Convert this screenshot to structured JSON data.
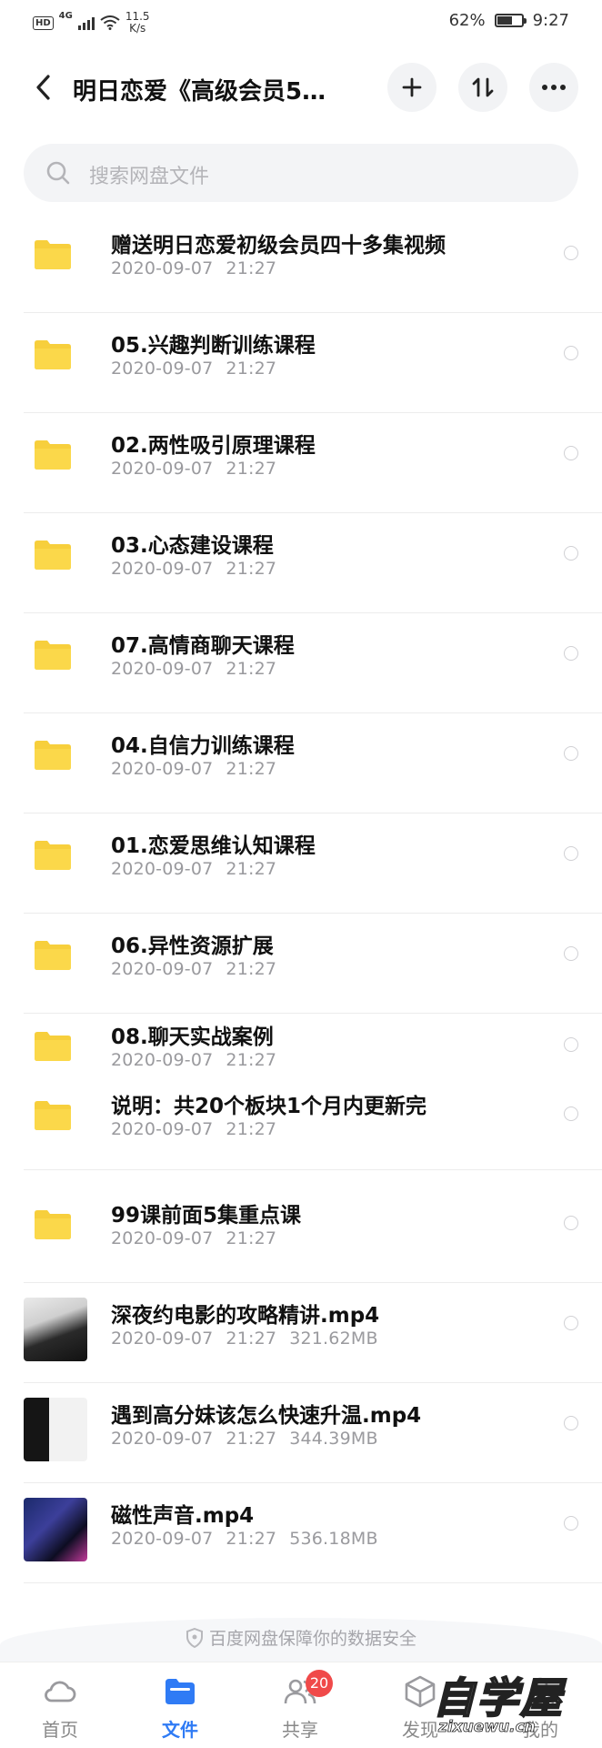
{
  "status_bar": {
    "hd": "HD",
    "network": "4G",
    "speed_value": "11.5",
    "speed_unit": "K/s",
    "battery": "62%",
    "battery_level": 0.62,
    "time": "9:27"
  },
  "header": {
    "title": "明日恋爱《高级会员5…",
    "icons": [
      "back-icon",
      "plus-icon",
      "sort-icon",
      "more-icon"
    ]
  },
  "search": {
    "placeholder": "搜索网盘文件"
  },
  "files": [
    {
      "name": "赠送明日恋爱初级会员四十多集视频",
      "date": "2020-09-07",
      "time": "21:27",
      "size": "",
      "type": "folder"
    },
    {
      "name": "05.兴趣判断训练课程",
      "date": "2020-09-07",
      "time": "21:27",
      "size": "",
      "type": "folder"
    },
    {
      "name": "02.两性吸引原理课程",
      "date": "2020-09-07",
      "time": "21:27",
      "size": "",
      "type": "folder"
    },
    {
      "name": "03.心态建设课程",
      "date": "2020-09-07",
      "time": "21:27",
      "size": "",
      "type": "folder"
    },
    {
      "name": "07.高情商聊天课程",
      "date": "2020-09-07",
      "time": "21:27",
      "size": "",
      "type": "folder"
    },
    {
      "name": "04.自信力训练课程",
      "date": "2020-09-07",
      "time": "21:27",
      "size": "",
      "type": "folder"
    },
    {
      "name": "01.恋爱思维认知课程",
      "date": "2020-09-07",
      "time": "21:27",
      "size": "",
      "type": "folder"
    },
    {
      "name": "06.异性资源扩展",
      "date": "2020-09-07",
      "time": "21:27",
      "size": "",
      "type": "folder"
    },
    {
      "name": "08.聊天实战案例",
      "date": "2020-09-07",
      "time": "21:27",
      "size": "",
      "type": "folder"
    },
    {
      "name": "说明：共20个板块1个月内更新完",
      "date": "2020-09-07",
      "time": "21:27",
      "size": "",
      "type": "folder"
    },
    {
      "name": "99课前面5集重点课",
      "date": "2020-09-07",
      "time": "21:27",
      "size": "",
      "type": "folder"
    },
    {
      "name": "深夜约电影的攻略精讲.mp4",
      "date": "2020-09-07",
      "time": "21:27",
      "size": "321.62MB",
      "type": "video"
    },
    {
      "name": "遇到高分妹该怎么快速升温.mp4",
      "date": "2020-09-07",
      "time": "21:27",
      "size": "344.39MB",
      "type": "video"
    },
    {
      "name": "磁性声音.mp4",
      "date": "2020-09-07",
      "time": "21:27",
      "size": "536.18MB",
      "type": "video"
    }
  ],
  "security_note": "百度网盘保障你的数据安全",
  "tabbar": {
    "tabs": [
      {
        "label": "首页",
        "icon": "cloud-icon"
      },
      {
        "label": "文件",
        "icon": "folder-icon"
      },
      {
        "label": "共享",
        "icon": "users-icon",
        "badge": "20"
      },
      {
        "label": "发现",
        "icon": "cube-icon"
      },
      {
        "label": "我的",
        "icon": "person-icon"
      }
    ],
    "active": "文件"
  },
  "watermark": {
    "title": "自学屋",
    "url": "zixuewu.cn"
  },
  "colors": {
    "accent": "#2f7bf5",
    "folder": "#f7cf3c",
    "badge": "#f04a4a"
  }
}
